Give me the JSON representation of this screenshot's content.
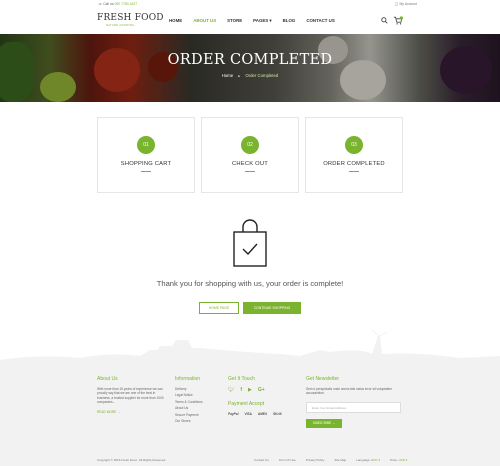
{
  "topbar": {
    "call_prefix": "Call us",
    "phone": "090 7783 4327",
    "account": "My Account"
  },
  "header": {
    "logo": "FRESH FOOD",
    "tagline": "NATURE GROWING",
    "nav": [
      {
        "label": "HOME",
        "active": false
      },
      {
        "label": "ABOUT US",
        "active": true
      },
      {
        "label": "STORE",
        "active": false
      },
      {
        "label": "PAGES ▾",
        "active": false
      },
      {
        "label": "BLOG",
        "active": false
      },
      {
        "label": "CONTACT US",
        "active": false
      }
    ],
    "cart_count": "0"
  },
  "hero": {
    "title": "ORDER COMPLETED",
    "crumb_home": "Home",
    "crumb_sep": "▸",
    "crumb_current": "Order Completed"
  },
  "steps": [
    {
      "num": "01",
      "label": "SHOPPING CART"
    },
    {
      "num": "02",
      "label": "CHECK OUT"
    },
    {
      "num": "03",
      "label": "ORDER COMPLETED"
    }
  ],
  "main": {
    "thanks": "Thank you for shopping with us, your order is complete!",
    "home_button": "HOME PAGE",
    "continue_button": "CONTINUE SHOPPING"
  },
  "footer": {
    "about": {
      "title": "About Us",
      "text": "With more than 15 years of experience we can proudly say that we are one of the best in business, a trusted supplier for more than 1000 companies...",
      "read_more": "READ MORE →"
    },
    "information": {
      "title": "Information",
      "items": [
        "Delivery",
        "Legal Notice",
        "Terms & Conditions",
        "About Us",
        "Secure Payment",
        "Our Stores"
      ]
    },
    "touch": {
      "title": "Get It Touch",
      "payment_title": "Payment Accept",
      "payments": [
        "PayPal",
        "VISA",
        "AMEX",
        "SKrill"
      ]
    },
    "newsletter": {
      "title": "Get Newsletter",
      "text": "Sed ut perspiciatis unde omnis iste natus error sit voluptatem accusantium",
      "placeholder": "Enter Your Email Address",
      "button": "SUBSCRIBE →"
    },
    "copyright": "Copyright © 2016 Fresh Food . All Rights Reserved",
    "links": [
      "Contact Us",
      "Term Of Use",
      "Privacy Policy",
      "Site Map"
    ],
    "language_label": "Language:",
    "language": "ENG ▾",
    "price_label": "Price:",
    "price": "USD ▾"
  },
  "colors": {
    "accent": "#7ab32e",
    "footer_bg": "#f2f2f2"
  }
}
